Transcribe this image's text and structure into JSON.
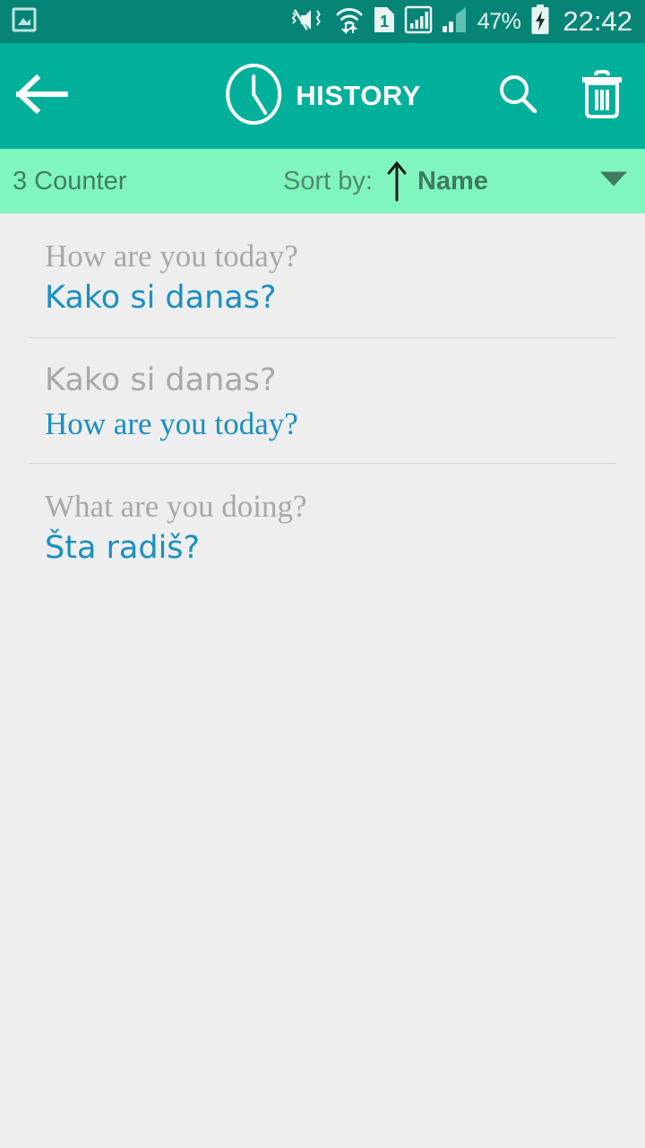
{
  "status_bar": {
    "icons": [
      "gallery-image-icon",
      "vibrate-mute-icon",
      "wifi-transfer-icon",
      "sim-one-icon",
      "signal-boxed-icon",
      "signal-bars-icon"
    ],
    "sim_label": "1",
    "battery_percent": "47%",
    "battery_state": "charging",
    "time": "22:42",
    "background": "#068577"
  },
  "action_bar": {
    "back_label": "back-arrow",
    "clock_icon": "clock-icon",
    "title": "HISTORY",
    "search_label": "search-icon",
    "delete_label": "trash-icon",
    "background": "#00b09b"
  },
  "sort_bar": {
    "counter": "3 Counter",
    "sort_label": "Sort by:",
    "direction": "ascending",
    "sort_value": "Name",
    "caret": "chevron-down-icon",
    "background": "#80f5bd"
  },
  "colors": {
    "source_text": "#a8a8a8",
    "target_text": "#1a8fc1",
    "list_background": "#eeeeee",
    "divider": "#d2d2d2"
  },
  "history": {
    "items": [
      {
        "source": "How are you today?",
        "target": "Kako si danas?",
        "source_style": "serif",
        "target_style": "sans"
      },
      {
        "source": "Kako si danas?",
        "target": "How are you today?",
        "source_style": "sans",
        "target_style": "serif"
      },
      {
        "source": "What are you doing?",
        "target": "Šta radiš?",
        "source_style": "serif",
        "target_style": "sans"
      }
    ]
  }
}
